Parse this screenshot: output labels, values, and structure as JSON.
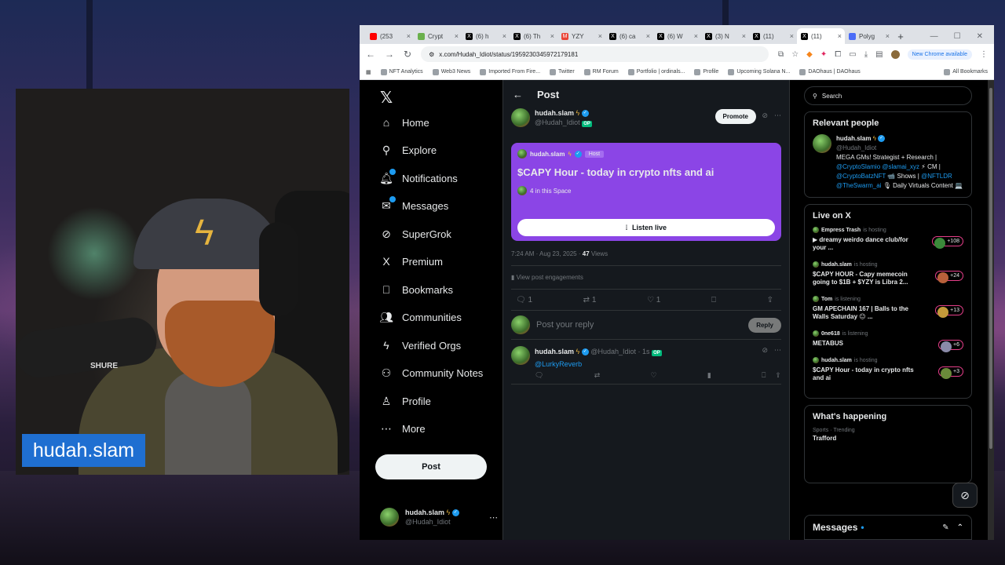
{
  "overlay": {
    "name_tag": "hudah.slam"
  },
  "webcam": {
    "mic_brand": "SHURE"
  },
  "browser": {
    "tabs": [
      {
        "label": "(253",
        "icon": "youtube-icon",
        "color": "#ff0000",
        "glyph": ""
      },
      {
        "label": "Crypt",
        "icon": "coin-icon",
        "color": "#6ab04c",
        "glyph": ""
      },
      {
        "label": "(6) h",
        "icon": "x-icon",
        "color": "#000000",
        "glyph": "X"
      },
      {
        "label": "(6) Th",
        "icon": "x-icon",
        "color": "#000000",
        "glyph": "X"
      },
      {
        "label": "YZY",
        "icon": "gmail-icon",
        "color": "#ea4335",
        "glyph": "M"
      },
      {
        "label": "(6) ca",
        "icon": "x-icon",
        "color": "#000000",
        "glyph": "X"
      },
      {
        "label": "(6) W",
        "icon": "x-icon",
        "color": "#000000",
        "glyph": "X"
      },
      {
        "label": "(3) N",
        "icon": "x-icon",
        "color": "#000000",
        "glyph": "X"
      },
      {
        "label": "(11)",
        "icon": "x-icon",
        "color": "#000000",
        "glyph": "X"
      },
      {
        "label": "(11)",
        "icon": "x-icon",
        "color": "#000000",
        "glyph": "X",
        "active": true
      },
      {
        "label": "Polyg",
        "icon": "polygon-icon",
        "color": "#4a6cf7",
        "glyph": ""
      }
    ],
    "url": "x.com/Hudah_Idiot/status/1959230345972179181",
    "chrome_available": "New Chrome available",
    "bookmarks": [
      "NFT Analytics",
      "Web3 News",
      "Imported From Fire...",
      "Twitter",
      "RM Forum",
      "Portfolio | ordinals...",
      "Profile",
      "Upcoming Solana N...",
      "DAOhaus | DAOhaus"
    ],
    "all_bookmarks": "All Bookmarks"
  },
  "nav": {
    "items": [
      {
        "label": "Home",
        "icon": "home-icon",
        "glyph": "⌂"
      },
      {
        "label": "Explore",
        "icon": "search-icon",
        "glyph": "⚲"
      },
      {
        "label": "Notifications",
        "icon": "bell-icon",
        "glyph": "🔔︎"
      },
      {
        "label": "Messages",
        "icon": "mail-icon",
        "glyph": "✉"
      },
      {
        "label": "SuperGrok",
        "icon": "grok-icon",
        "glyph": "⊘"
      },
      {
        "label": "Premium",
        "icon": "x-icon",
        "glyph": "X"
      },
      {
        "label": "Bookmarks",
        "icon": "bookmark-icon",
        "glyph": "⎕"
      },
      {
        "label": "Communities",
        "icon": "communities-icon",
        "glyph": "👥︎"
      },
      {
        "label": "Verified Orgs",
        "icon": "lightning-icon",
        "glyph": "ϟ"
      },
      {
        "label": "Community Notes",
        "icon": "community-notes-icon",
        "glyph": "⚇"
      },
      {
        "label": "Profile",
        "icon": "person-icon",
        "glyph": "♙"
      },
      {
        "label": "More",
        "icon": "more-circle-icon",
        "glyph": "⋯"
      }
    ],
    "post_button": "Post",
    "account": {
      "name": "hudah.slam",
      "handle": "@Hudah_Idiot"
    }
  },
  "post": {
    "header": "Post",
    "author": {
      "name": "hudah.slam",
      "handle": "@Hudah_Idiot",
      "op": "OP"
    },
    "promote": "Promote",
    "space": {
      "host_name": "hudah.slam",
      "host_tag": "Host",
      "title": "$CAPY Hour - today in crypto nfts and ai",
      "listeners": "4 in this Space",
      "listen_button": "Listen live"
    },
    "time": "7:24 AM · Aug 23, 2025 ·",
    "views_count": "47",
    "views_label": "Views",
    "engagements": "View post engagements",
    "actions": {
      "replies": "1",
      "reposts": "1",
      "likes": "1"
    },
    "reply_placeholder": "Post your reply",
    "reply_button": "Reply"
  },
  "comment": {
    "name": "hudah.slam",
    "handle": "@Hudah_Idiot",
    "time": "· 1s",
    "op": "OP",
    "mention": "@LurkyReverb"
  },
  "sidebar": {
    "search_placeholder": "Search",
    "relevant": {
      "title": "Relevant people",
      "name": "hudah.slam",
      "handle": "@Hudah_Idiot",
      "bio_1": "MEGA GMs! Strategist + Research |",
      "bio_2": "@CryptoSlamio @slamai_xyz",
      "bio_3": "⚡ CM |",
      "bio_4": "@CryptoBatzNFT",
      "bio_5": "📹 Shows |",
      "bio_6": "@NFTLDR @TheSwarm_ai",
      "bio_7": "🎙 Daily Virtuals Content 💻"
    },
    "live": {
      "title": "Live on X",
      "items": [
        {
          "host": "Empress Trash",
          "status": "is hosting",
          "title": "▶ dreamy weirdo dance club/for your ...",
          "count": "+108"
        },
        {
          "host": "hudah.slam",
          "status": "is hosting",
          "title": "$CAPY HOUR - Capy memecoin going to $1B + $YZY is Libra 2...",
          "count": "+24"
        },
        {
          "host": "Tom",
          "status": "is listening",
          "title": "GM APECHAIN 167 | Balls to the Walls Saturday 😐 ...",
          "count": "+13"
        },
        {
          "host": "0ne618",
          "status": "is listening",
          "title": "METABUS",
          "count": "+6"
        },
        {
          "host": "hudah.slam",
          "status": "is hosting",
          "title": "$CAPY Hour - today in crypto nfts and ai",
          "count": "+3"
        }
      ]
    },
    "happening": {
      "title": "What's happening",
      "category": "Sports · Trending",
      "trend": "Trafford"
    },
    "messages_bar": "Messages"
  }
}
